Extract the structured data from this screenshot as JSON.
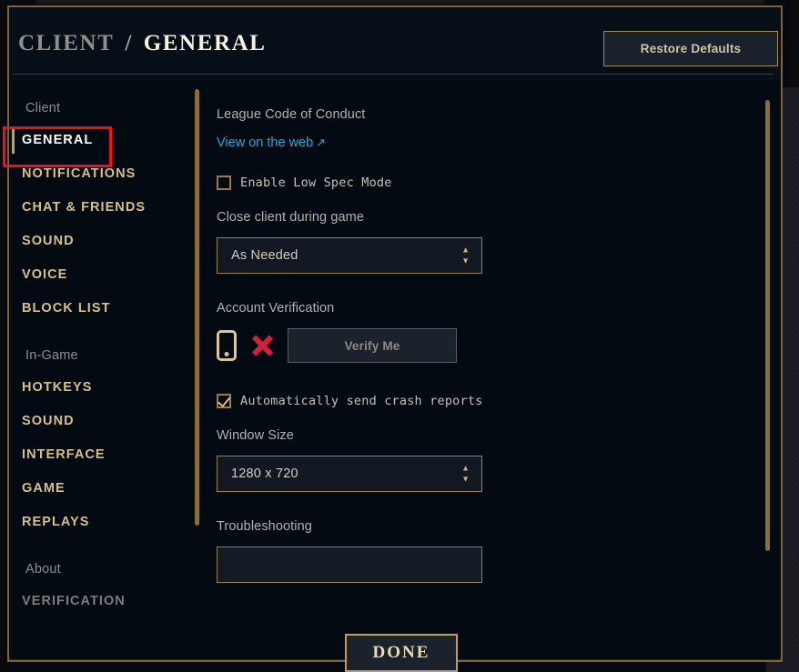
{
  "window": {
    "accent_gold": "#a68b4c",
    "background": "#030a12",
    "link_color": "#27a8d6",
    "annotation_color": "#f60d1a"
  },
  "header": {
    "breadcrumb_section": "CLIENT",
    "breadcrumb_separator": "/",
    "breadcrumb_current": "GENERAL",
    "restore_defaults_label": "Restore Defaults"
  },
  "sidebar": {
    "groups": [
      {
        "label": "Client",
        "items": [
          {
            "label": "GENERAL",
            "state": "selected"
          },
          {
            "label": "NOTIFICATIONS",
            "state": "normal"
          },
          {
            "label": "CHAT & FRIENDS",
            "state": "normal"
          },
          {
            "label": "SOUND",
            "state": "normal"
          },
          {
            "label": "VOICE",
            "state": "normal"
          },
          {
            "label": "BLOCK LIST",
            "state": "normal"
          }
        ]
      },
      {
        "label": "In-Game",
        "items": [
          {
            "label": "HOTKEYS",
            "state": "normal"
          },
          {
            "label": "SOUND",
            "state": "normal"
          },
          {
            "label": "INTERFACE",
            "state": "normal"
          },
          {
            "label": "GAME",
            "state": "normal"
          },
          {
            "label": "REPLAYS",
            "state": "normal"
          }
        ]
      },
      {
        "label": "About",
        "items": [
          {
            "label": "VERIFICATION",
            "state": "muted"
          }
        ]
      }
    ]
  },
  "main": {
    "code_of_conduct": {
      "label": "League Code of Conduct",
      "link_text": "View on the web",
      "link_arrow": "↗"
    },
    "low_spec": {
      "label": "Enable Low Spec Mode",
      "checked": false
    },
    "close_client": {
      "label": "Close client during game",
      "value": "As Needed",
      "spinner_up": "▲",
      "spinner_down": "▼"
    },
    "account_verification": {
      "label": "Account Verification",
      "status_icon": "phone-icon",
      "status_mark": "x-mark",
      "verify_button_label": "Verify Me",
      "verify_button_enabled": false
    },
    "crash_reports": {
      "label": "Automatically send crash reports",
      "checked": true
    },
    "window_size": {
      "label": "Window Size",
      "value": "1280 x 720",
      "spinner_up": "▲",
      "spinner_down": "▼"
    },
    "troubleshooting": {
      "label": "Troubleshooting",
      "button_label": ""
    }
  },
  "footer": {
    "done_label": "DONE"
  }
}
